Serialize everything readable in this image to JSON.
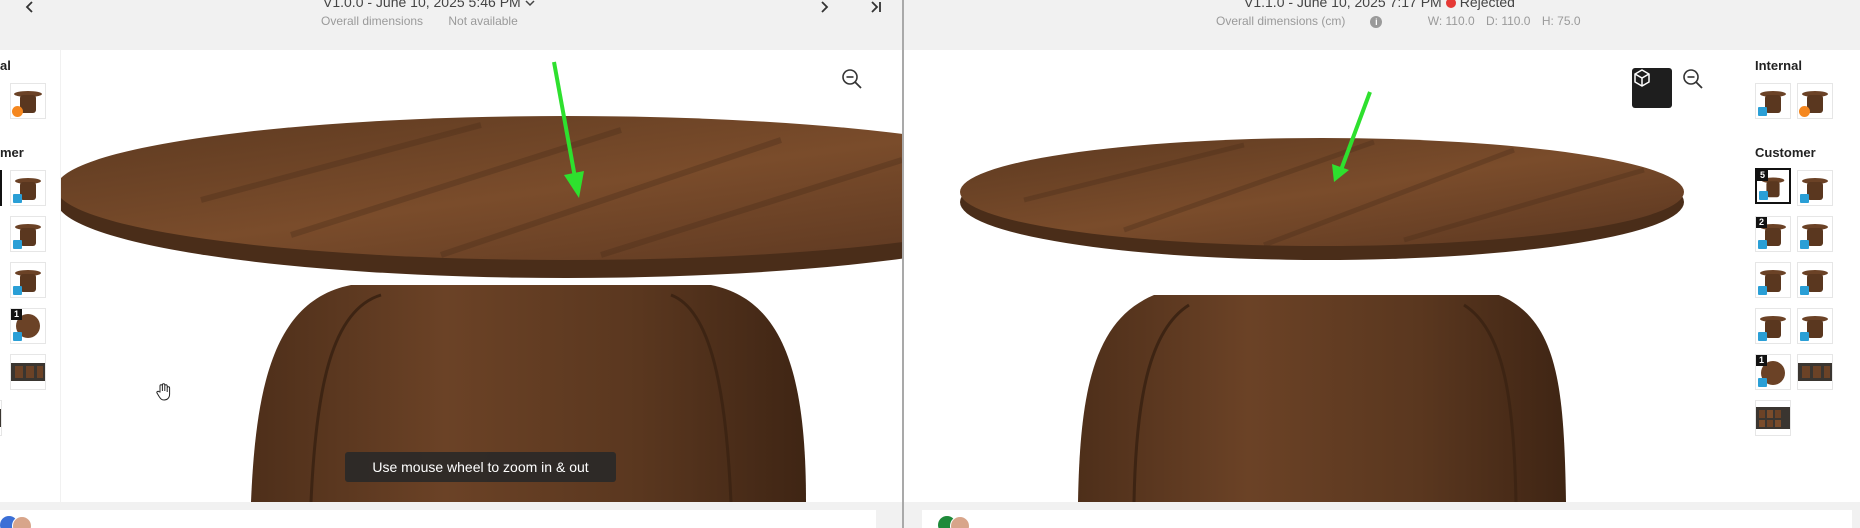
{
  "left": {
    "version_title": "V1.0.0 - June 10, 2025 5:46 PM",
    "dim_label": "Overall dimensions",
    "dim_value": "Not available",
    "sidebar": {
      "internal_label": "al",
      "customer_label": "mer"
    },
    "badges": {
      "thumb_round_top": "1"
    },
    "zoom_hint": "Use mouse wheel to zoom in & out"
  },
  "right": {
    "version_title": "V1.1.0 - June 10, 2025 7:17 PM",
    "status": "Rejected",
    "status_color": "#e53935",
    "dim_label": "Overall dimensions (cm)",
    "dim_w": "W: 110.0",
    "dim_d": "D: 110.0",
    "dim_h": "H: 75.0",
    "sidebar": {
      "internal_label": "Internal",
      "customer_label": "Customer"
    },
    "badges": {
      "selected": "5",
      "second_row": "2",
      "round_top": "1"
    }
  },
  "icons": {
    "prev": "chevron-left-icon",
    "next": "chevron-right-icon",
    "last": "skip-to-end-icon",
    "zoom_out": "zoom-out-icon",
    "cube": "cube-icon",
    "hand": "hand-cursor-icon",
    "info": "info-icon"
  },
  "colors": {
    "wood": "#6b4226",
    "annotation_arrow": "#2ee02e",
    "panel": "#f1f1f1",
    "status_rejected": "#e53935"
  }
}
